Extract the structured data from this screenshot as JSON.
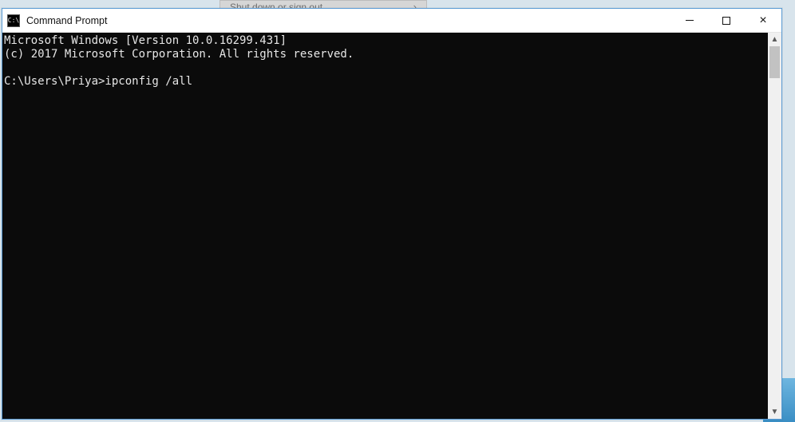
{
  "background": {
    "menu_item": "Shut down or sign out",
    "menu_chevron_glyph": "›"
  },
  "window": {
    "title": "Command Prompt",
    "icon_glyph": "C:\\",
    "controls": {
      "minimize_glyph": "—",
      "maximize_glyph": "□",
      "close_glyph": "×"
    }
  },
  "terminal": {
    "lines": [
      "Microsoft Windows [Version 10.0.16299.431]",
      "(c) 2017 Microsoft Corporation. All rights reserved.",
      "",
      "C:\\Users\\Priya>ipconfig /all"
    ],
    "prompt": "C:\\Users\\Priya>",
    "last_command": "ipconfig /all"
  }
}
